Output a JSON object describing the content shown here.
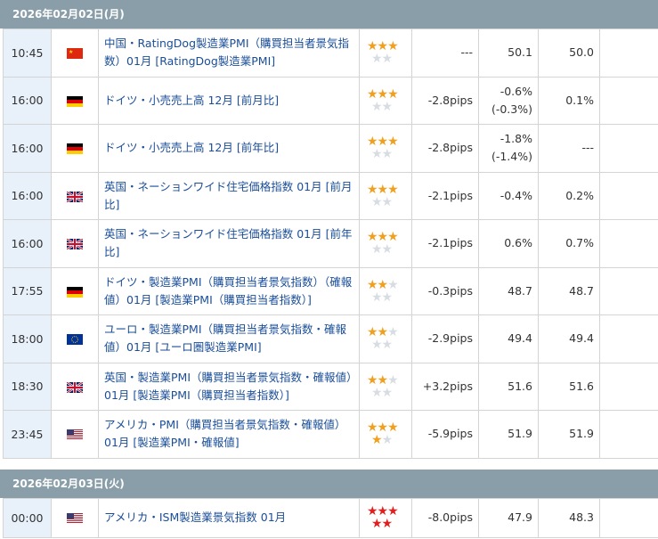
{
  "days": [
    {
      "date": "2026年02月02日(月)",
      "rows": [
        {
          "time": "10:45",
          "flag": "cn",
          "name": "中国・RatingDog製造業PMI（購買担当者景気指数）01月 [RatingDog製造業PMI]",
          "stars": "3-orange",
          "impact": "---",
          "previous": "50.1",
          "forecast": "50.0",
          "actual": "---"
        },
        {
          "time": "16:00",
          "flag": "de",
          "name": "ドイツ・小売売上高 12月 [前月比]",
          "stars": "3-orange",
          "impact": "-2.8pips",
          "previous": "-0.6%\n(-0.3%)",
          "forecast": "0.1%",
          "actual": "---"
        },
        {
          "time": "16:00",
          "flag": "de",
          "name": "ドイツ・小売売上高 12月 [前年比]",
          "stars": "3-orange",
          "impact": "-2.8pips",
          "previous": "-1.8%\n(-1.4%)",
          "forecast": "---",
          "actual": "---"
        },
        {
          "time": "16:00",
          "flag": "gb",
          "name": "英国・ネーションワイド住宅価格指数 01月 [前月比]",
          "stars": "3-orange",
          "impact": "-2.1pips",
          "previous": "-0.4%",
          "forecast": "0.2%",
          "actual": "---"
        },
        {
          "time": "16:00",
          "flag": "gb",
          "name": "英国・ネーションワイド住宅価格指数 01月 [前年比]",
          "stars": "3-orange",
          "impact": "-2.1pips",
          "previous": "0.6%",
          "forecast": "0.7%",
          "actual": "---"
        },
        {
          "time": "17:55",
          "flag": "de",
          "name": "ドイツ・製造業PMI（購買担当者景気指数）（確報値）01月 [製造業PMI（購買担当者指数）]",
          "stars": "2-orange",
          "impact": "-0.3pips",
          "previous": "48.7",
          "forecast": "48.7",
          "actual": "---"
        },
        {
          "time": "18:00",
          "flag": "eu",
          "name": "ユーロ・製造業PMI（購買担当者景気指数・確報値）01月 [ユーロ圏製造業PMI]",
          "stars": "2-orange",
          "impact": "-2.9pips",
          "previous": "49.4",
          "forecast": "49.4",
          "actual": "---"
        },
        {
          "time": "18:30",
          "flag": "gb",
          "name": "英国・製造業PMI（購買担当者景気指数・確報値）01月 [製造業PMI（購買担当者指数）]",
          "stars": "2-orange",
          "impact": "+3.2pips",
          "previous": "51.6",
          "forecast": "51.6",
          "actual": "---"
        },
        {
          "time": "23:45",
          "flag": "us",
          "name": "アメリカ・PMI（購買担当者景気指数・確報値）01月 [製造業PMI・確報値]",
          "stars": "4-orange",
          "impact": "-5.9pips",
          "previous": "51.9",
          "forecast": "51.9",
          "actual": "---"
        }
      ]
    },
    {
      "date": "2026年02月03日(火)",
      "rows": [
        {
          "time": "00:00",
          "flag": "us",
          "name": "アメリカ・ISM製造業景気指数 01月",
          "stars": "5-red",
          "impact": "-8.0pips",
          "previous": "47.9",
          "forecast": "48.3",
          "actual": "---"
        }
      ]
    }
  ],
  "colors": {
    "header_bg": "#8a9eaa",
    "time_bg": "#e8f1fa",
    "link": "#1a4e98",
    "star_on": "#f0a020",
    "star_red": "#e02020"
  }
}
